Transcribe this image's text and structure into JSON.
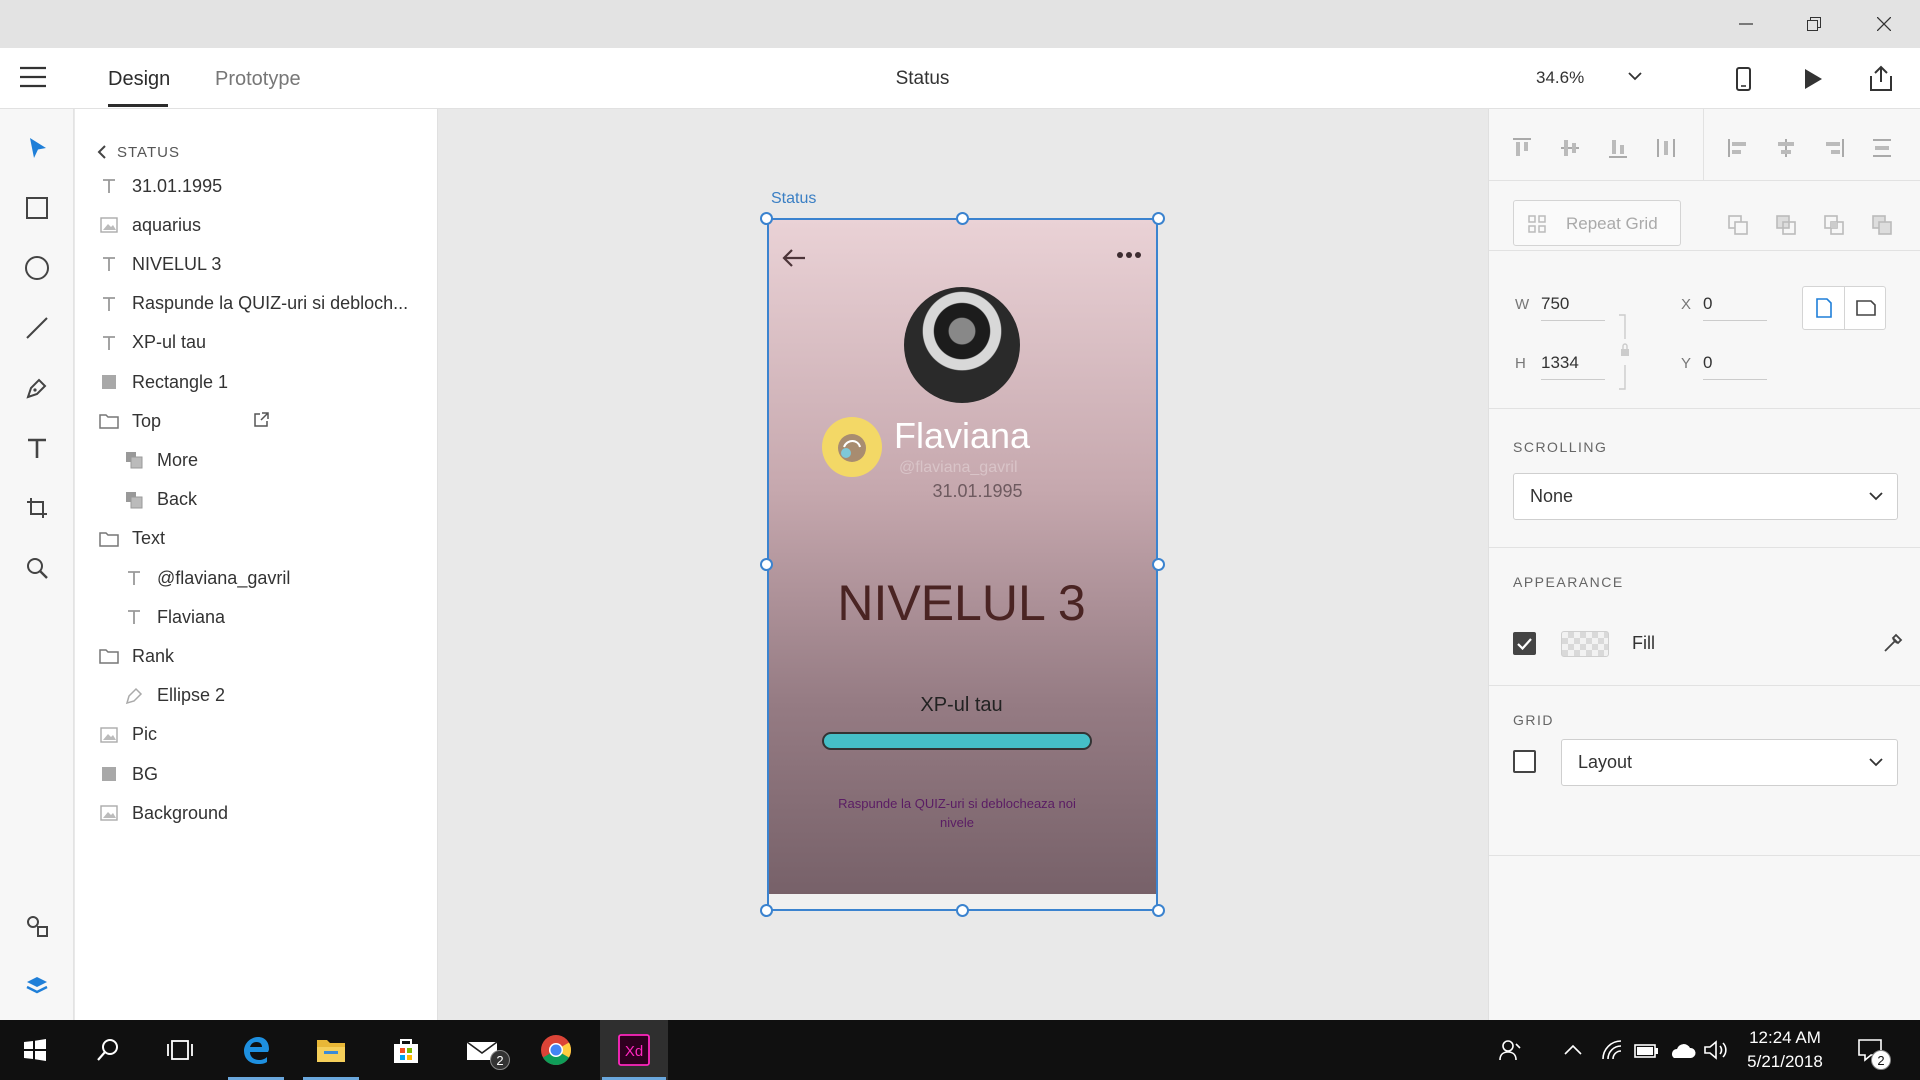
{
  "app": {
    "document_title": "Status",
    "zoom": "34.6%"
  },
  "mode_tabs": {
    "design": "Design",
    "prototype": "Prototype"
  },
  "layers": {
    "breadcrumb": "STATUS",
    "items": [
      {
        "label": "31.01.1995",
        "icon": "text-icon",
        "indent": 0
      },
      {
        "label": "aquarius",
        "icon": "image-icon",
        "indent": 0
      },
      {
        "label": "NIVELUL 3",
        "icon": "text-icon",
        "indent": 0
      },
      {
        "label": "Raspunde la QUIZ-uri si debloch...",
        "icon": "text-icon",
        "indent": 0
      },
      {
        "label": "XP-ul tau",
        "icon": "text-icon",
        "indent": 0
      },
      {
        "label": "Rectangle 1",
        "icon": "rectangle-icon",
        "indent": 0
      },
      {
        "label": "Top",
        "icon": "folder-icon",
        "indent": 0
      },
      {
        "label": "More",
        "icon": "symbol-icon",
        "indent": 1
      },
      {
        "label": "Back",
        "icon": "symbol-icon",
        "indent": 1
      },
      {
        "label": "Text",
        "icon": "folder-icon",
        "indent": 0
      },
      {
        "label": "@flaviana_gavril",
        "icon": "text-icon",
        "indent": 1
      },
      {
        "label": "Flaviana",
        "icon": "text-icon",
        "indent": 1
      },
      {
        "label": "Rank",
        "icon": "folder-icon",
        "indent": 0
      },
      {
        "label": "Ellipse 2",
        "icon": "pen-path-icon",
        "indent": 1
      },
      {
        "label": "Pic",
        "icon": "image-icon",
        "indent": 0
      },
      {
        "label": "BG",
        "icon": "rectangle-icon",
        "indent": 0
      },
      {
        "label": "Background",
        "icon": "image-icon",
        "indent": 0
      }
    ]
  },
  "artboard": {
    "label": "Status",
    "name": "Flaviana",
    "handle": "@flaviana_gavril",
    "birthdate": "31.01.1995",
    "level": "NIVELUL 3",
    "xp_label": "XP-ul tau",
    "xp_progress": 1.0,
    "quiz_text": "Raspunde la QUIZ-uri si deblocheaza noi nivele"
  },
  "properties": {
    "repeat_grid": "Repeat Grid",
    "w_label": "W",
    "w_value": "750",
    "h_label": "H",
    "h_value": "1334",
    "x_label": "X",
    "x_value": "0",
    "y_label": "Y",
    "y_value": "0",
    "scrolling_title": "SCROLLING",
    "scrolling_value": "None",
    "appearance_title": "APPEARANCE",
    "fill_label": "Fill",
    "fill_checked": true,
    "grid_title": "GRID",
    "grid_value": "Layout",
    "grid_checked": false
  },
  "taskbar": {
    "mail_badge": "2",
    "time": "12:24 AM",
    "date": "5/21/2018",
    "notification_badge": "2"
  },
  "colors": {
    "accent": "#3b83cf",
    "xd_brand": "#ff26be",
    "xp_bar": "#45bfc7"
  }
}
